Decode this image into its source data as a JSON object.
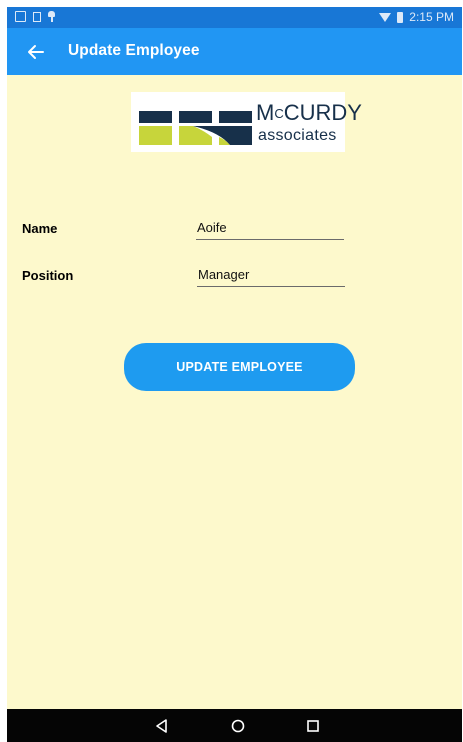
{
  "status_bar": {
    "time": "2:15 PM",
    "left_icons": [
      "gallery-notification-icon",
      "sd-card-icon",
      "pin-icon"
    ],
    "right_icons": [
      "wifi-icon",
      "battery-icon"
    ]
  },
  "app_bar": {
    "title": "Update Employee",
    "back_icon": "arrow-left-icon"
  },
  "logo": {
    "line1_prefix": "M",
    "line1_superscript": "C",
    "line1_rest": "CURDY",
    "line2": "associates",
    "colors": {
      "navy": "#17304a",
      "lime": "#c7d53b"
    }
  },
  "form": {
    "name_label": "Name",
    "name_value": "Aoife",
    "position_label": "Position",
    "position_value": "Manager"
  },
  "update_button": {
    "label": "UPDATE EMPLOYEE"
  },
  "nav_bar": {
    "icons": [
      "back-triangle-icon",
      "home-circle-icon",
      "recents-square-icon"
    ]
  },
  "colors": {
    "status_bar": "#1877d6",
    "app_bar": "#2196f3",
    "background": "#fdf9cc",
    "button": "#1e9bf0",
    "nav_bar": "#050505"
  }
}
